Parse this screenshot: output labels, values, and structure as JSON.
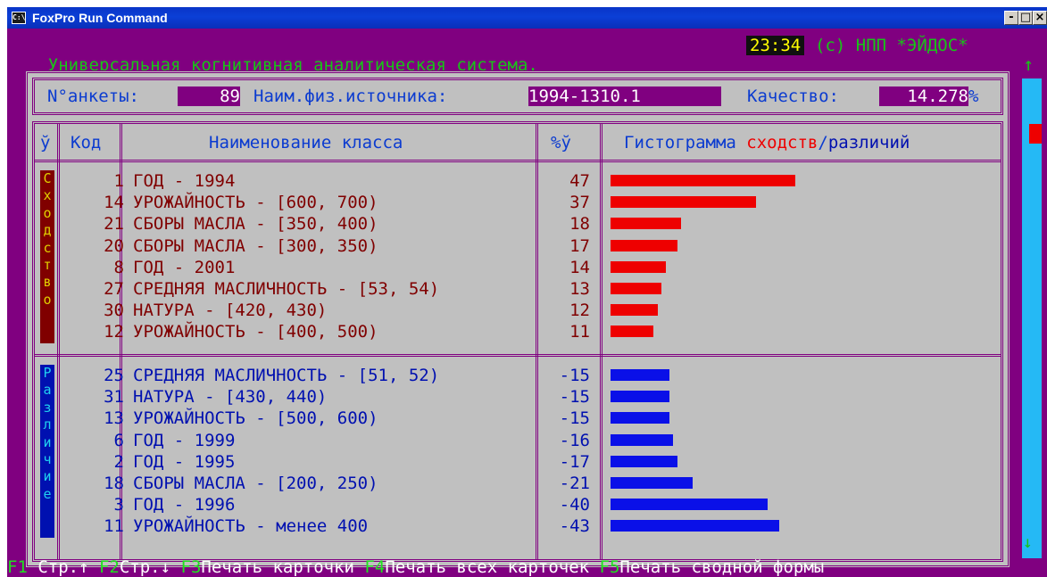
{
  "window": {
    "title": "FoxPro Run Command",
    "icon_text": "C:\\",
    "buttons": [
      "-",
      "□",
      "×"
    ]
  },
  "topline": {
    "system_name": "Универсальная когнитивная аналитическая система.",
    "time": "23:34",
    "copyright": "(с) НПП *ЭЙДОС*"
  },
  "scroll": {
    "up": "↑",
    "down": "↓"
  },
  "header": {
    "anketa_label": "N°анкеты:",
    "anketa_value": "89",
    "source_label": "Наим.физ.источника:",
    "source_value": "1994-1310.1",
    "quality_label": "Качество:",
    "quality_value": "14.278",
    "quality_unit": "%"
  },
  "columns": {
    "marker": "ў",
    "code": "Код",
    "name": "Наименование класса",
    "pct": "%ў",
    "hist_prefix": "Гистограмма ",
    "hist_similarity": "сходств",
    "hist_sep": "/",
    "hist_difference": "различий"
  },
  "similarity_label": [
    "С",
    "х",
    "о",
    "д",
    "с",
    "т",
    "в",
    "о"
  ],
  "difference_label": [
    "Р",
    "а",
    "з",
    "л",
    "и",
    "ч",
    "и",
    "е"
  ],
  "similarity_rows": [
    {
      "code": "1",
      "name": "ГОД - 1994",
      "pct": "47",
      "value": 47
    },
    {
      "code": "14",
      "name": "УРОЖАЙНОСТЬ - [600, 700)",
      "pct": "37",
      "value": 37
    },
    {
      "code": "21",
      "name": "СБОРЫ МАСЛА - [350, 400)",
      "pct": "18",
      "value": 18
    },
    {
      "code": "20",
      "name": "СБОРЫ МАСЛА - [300, 350)",
      "pct": "17",
      "value": 17
    },
    {
      "code": "8",
      "name": "ГОД - 2001",
      "pct": "14",
      "value": 14
    },
    {
      "code": "27",
      "name": "СРЕДНЯЯ МАСЛИЧНОСТЬ - [53, 54)",
      "pct": "13",
      "value": 13
    },
    {
      "code": "30",
      "name": "НАТУРА - [420, 430)",
      "pct": "12",
      "value": 12
    },
    {
      "code": "12",
      "name": "УРОЖАЙНОСТЬ - [400, 500)",
      "pct": "11",
      "value": 11
    }
  ],
  "difference_rows": [
    {
      "code": "25",
      "name": "СРЕДНЯЯ МАСЛИЧНОСТЬ - [51, 52)",
      "pct": "-15",
      "value": 15
    },
    {
      "code": "31",
      "name": "НАТУРА - [430, 440)",
      "pct": "-15",
      "value": 15
    },
    {
      "code": "13",
      "name": "УРОЖАЙНОСТЬ - [500, 600)",
      "pct": "-15",
      "value": 15
    },
    {
      "code": "6",
      "name": "ГОД - 1999",
      "pct": "-16",
      "value": 16
    },
    {
      "code": "2",
      "name": "ГОД - 1995",
      "pct": "-17",
      "value": 17
    },
    {
      "code": "18",
      "name": "СБОРЫ МАСЛА - [200, 250)",
      "pct": "-21",
      "value": 21
    },
    {
      "code": "3",
      "name": "ГОД - 1996",
      "pct": "-40",
      "value": 40
    },
    {
      "code": "11",
      "name": "УРОЖАЙНОСТЬ - менее 400",
      "pct": "-43",
      "value": 43
    }
  ],
  "fkeys": [
    {
      "key": "F1",
      "label": " Стр.↑ "
    },
    {
      "key": "F2",
      "label": "Стр.↓ "
    },
    {
      "key": "F3",
      "label": "Печать карточки "
    },
    {
      "key": "F4",
      "label": "Печать всех карточек "
    },
    {
      "key": "F5",
      "label": "Печать сводной формы"
    }
  ],
  "colors": {
    "console_bg": "#800080",
    "panel_bg": "#c0c0c0",
    "similarity_bar": "#ee0000",
    "difference_bar": "#0a10e8"
  }
}
